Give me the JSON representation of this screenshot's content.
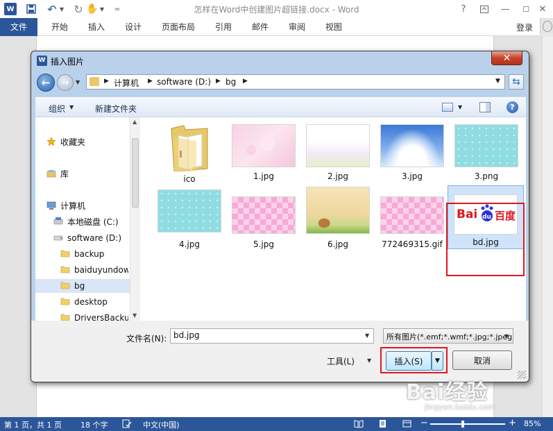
{
  "word": {
    "title": "怎样在Word中创建图片超链接.docx - Word",
    "logo_letter": "W",
    "quick_access": {
      "more": "="
    },
    "window_buttons": {
      "help": "?",
      "minimize": "—",
      "maximize": "☐",
      "close": "✕"
    },
    "tabs": [
      {
        "label": "文件"
      },
      {
        "label": "开始"
      },
      {
        "label": "插入"
      },
      {
        "label": "设计"
      },
      {
        "label": "页面布局"
      },
      {
        "label": "引用"
      },
      {
        "label": "邮件"
      },
      {
        "label": "审阅"
      },
      {
        "label": "视图"
      }
    ],
    "login": "登录"
  },
  "dialog": {
    "title": "插入图片",
    "icon_letter": "W",
    "address": [
      "计算机",
      "software (D:)",
      "bg"
    ],
    "toolbar": {
      "organize": "组织",
      "new_folder": "新建文件夹",
      "help": "?"
    },
    "nav": [
      {
        "label": "收藏夹",
        "icon": "star-icon"
      },
      {
        "label": "库",
        "icon": "library-icon"
      },
      {
        "label": "计算机",
        "icon": "computer-icon"
      },
      {
        "label": "本地磁盘 (C:)",
        "icon": "drive-icon"
      },
      {
        "label": "software (D:)",
        "icon": "drive-icon"
      },
      {
        "label": "backup",
        "icon": "folder-icon"
      },
      {
        "label": "baiduyundownload",
        "icon": "folder-icon"
      },
      {
        "label": "bg",
        "icon": "folder-icon",
        "selected": true
      },
      {
        "label": "desktop",
        "icon": "folder-icon"
      },
      {
        "label": "DriversBackup",
        "icon": "folder-icon"
      }
    ],
    "files": [
      {
        "name": "ico",
        "kind": "folder"
      },
      {
        "name": "1.jpg",
        "kind": "pink-hearts"
      },
      {
        "name": "2.jpg",
        "kind": "white-fade"
      },
      {
        "name": "3.jpg",
        "kind": "blue-sky"
      },
      {
        "name": "3.png",
        "kind": "cyan-dots"
      },
      {
        "name": "4.jpg",
        "kind": "cyan-dots"
      },
      {
        "name": "5.jpg",
        "kind": "pink-check"
      },
      {
        "name": "6.jpg",
        "kind": "beige-house"
      },
      {
        "name": "772469315.gif",
        "kind": "pink-check"
      },
      {
        "name": "bd.jpg",
        "kind": "baidu-logo",
        "selected": true
      }
    ],
    "baidu_logo": {
      "bai": "Bai",
      "du": "du",
      "cn": "百度"
    },
    "filename_label": "文件名(N):",
    "filename_value": "bd.jpg",
    "filetype": "所有图片(*.emf;*.wmf;*.jpg;*.jpeg)",
    "tools": "工具(L)",
    "insert": "插入(S)",
    "cancel": "取消",
    "close": "✕"
  },
  "status": {
    "page": "第 1 页，共 1 页",
    "words": "18 个字",
    "lang": "中文(中国)",
    "zoom": "85%",
    "zoom_minus": "−",
    "zoom_plus": "+"
  },
  "watermark": {
    "brand": "Bai经验",
    "url": "jingyan.baidu.com"
  },
  "colors": {
    "word_blue": "#2b579a",
    "selection_red": "#e0161c",
    "dialog_frame": "#b9d1ea"
  }
}
